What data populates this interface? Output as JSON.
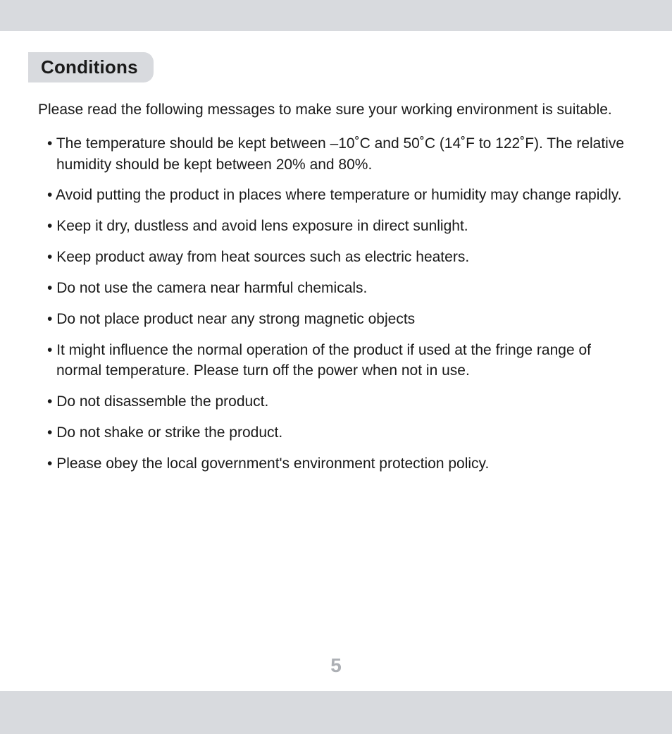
{
  "heading": "Conditions",
  "intro": "Please read the following messages to make sure your working environment is suitable.",
  "bullets": [
    "The temperature should be kept between –10˚C and 50˚C (14˚F to 122˚F). The relative humidity should be kept between 20% and 80%.",
    "Avoid putting the product in places where temperature or humidity may change rapidly.",
    "Keep it dry, dustless and avoid lens exposure in direct sunlight.",
    "Keep product away from heat sources such as electric heaters.",
    "Do not use the camera near harmful chemicals.",
    "Do not place product near any strong magnetic objects",
    "It might influence the normal operation of the product if used at the fringe range of normal temperature. Please turn off the power when not in use.",
    "Do not disassemble the product.",
    "Do not shake or strike the product.",
    "Please obey the local government's environment protection policy."
  ],
  "pageNumber": "5"
}
